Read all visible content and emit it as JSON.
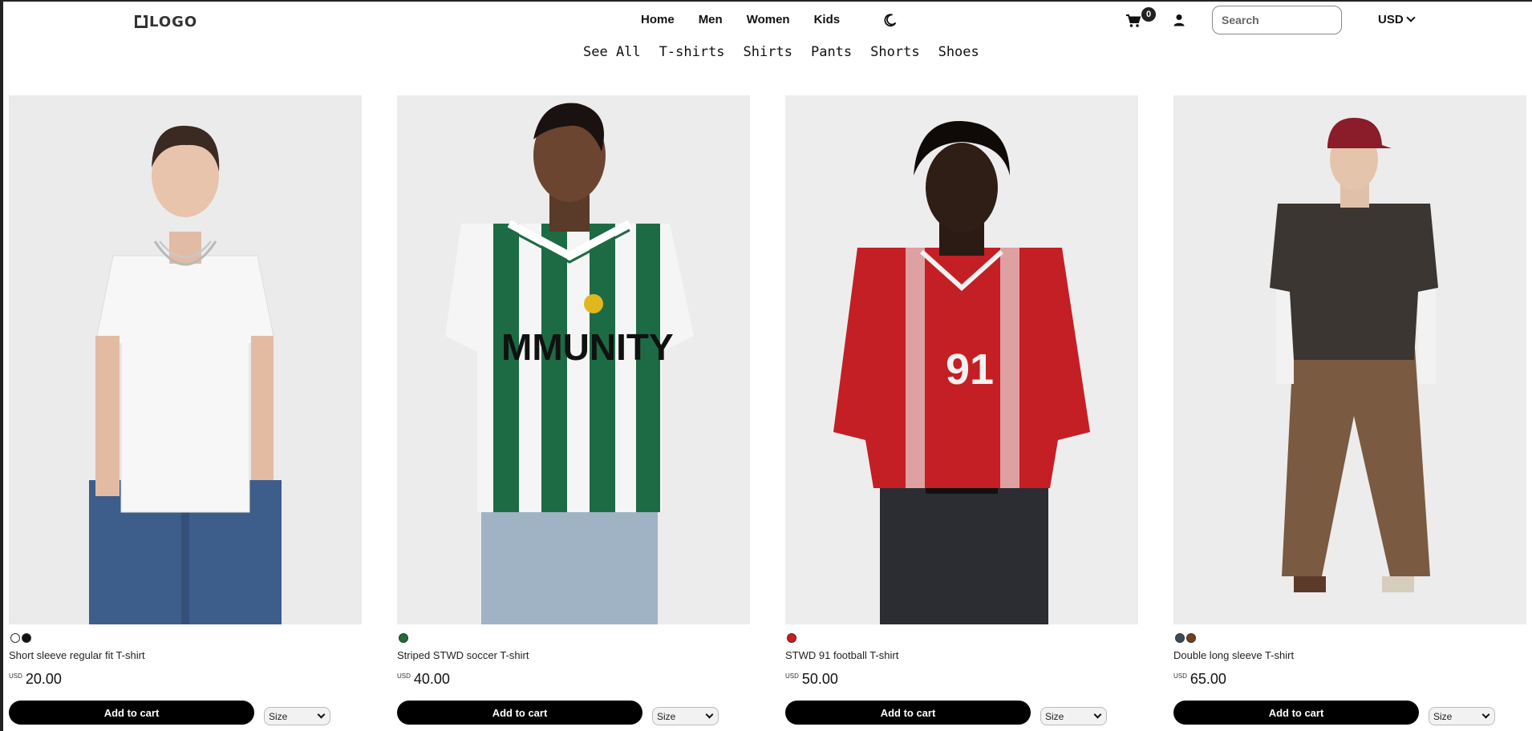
{
  "header": {
    "logo": "LOGO",
    "nav": [
      "Home",
      "Men",
      "Women",
      "Kids"
    ],
    "cart_count": "0",
    "search_placeholder": "Search",
    "currency": "USD"
  },
  "categories": [
    "See All",
    "T-shirts",
    "Shirts",
    "Pants",
    "Shorts",
    "Shoes"
  ],
  "products": [
    {
      "name": "Short sleeve regular fit T-shirt",
      "currency": "USD",
      "price": "20.00",
      "add_label": "Add to cart",
      "size_label": "Size",
      "swatches": [
        "#ffffff",
        "#111111"
      ]
    },
    {
      "name": "Striped STWD soccer T-shirt",
      "currency": "USD",
      "price": "40.00",
      "add_label": "Add to cart",
      "size_label": "Size",
      "swatches": [
        "#1f6b3a"
      ]
    },
    {
      "name": "STWD 91 football T-shirt",
      "currency": "USD",
      "price": "50.00",
      "add_label": "Add to cart",
      "size_label": "Size",
      "swatches": [
        "#d11a1a"
      ]
    },
    {
      "name": "Double long sleeve T-shirt",
      "currency": "USD",
      "price": "65.00",
      "add_label": "Add to cart",
      "size_label": "Size",
      "swatches": [
        "#3c4a5a",
        "#7a3d1a"
      ]
    }
  ],
  "photo_text": {
    "shirt2": "MMUNITY",
    "shirt3": "91"
  },
  "icons": [
    "moon-icon",
    "cart-icon",
    "user-icon",
    "chevron-down-icon"
  ]
}
